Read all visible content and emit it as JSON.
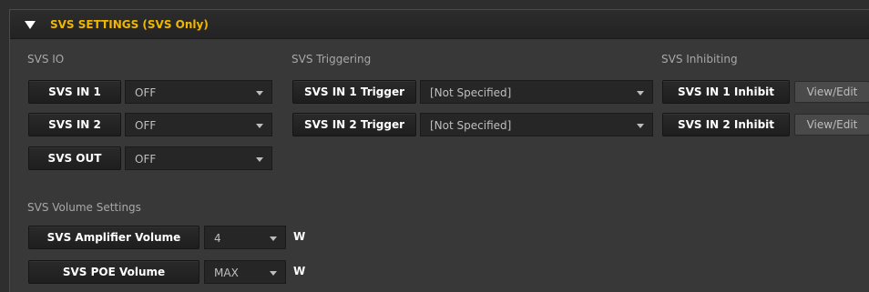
{
  "header": {
    "title": "SVS SETTINGS (SVS Only)"
  },
  "io": {
    "label": "SVS IO",
    "rows": [
      {
        "button": "SVS IN 1",
        "value": "OFF"
      },
      {
        "button": "SVS IN 2",
        "value": "OFF"
      },
      {
        "button": "SVS OUT",
        "value": "OFF"
      }
    ]
  },
  "triggering": {
    "label": "SVS Triggering",
    "rows": [
      {
        "button": "SVS IN 1 Trigger",
        "value": "[Not Specified]"
      },
      {
        "button": "SVS IN 2 Trigger",
        "value": "[Not Specified]"
      }
    ]
  },
  "inhibiting": {
    "label": "SVS Inhibiting",
    "rows": [
      {
        "button": "SVS IN 1 Inhibit",
        "action": "View/Edit"
      },
      {
        "button": "SVS IN 2 Inhibit",
        "action": "View/Edit"
      }
    ]
  },
  "volume": {
    "label": "SVS Volume Settings",
    "rows": [
      {
        "button": "SVS Amplifier Volume",
        "value": "4",
        "unit": "W"
      },
      {
        "button": "SVS POE Volume",
        "value": "MAX",
        "unit": "W"
      }
    ]
  },
  "colors": {
    "accent": "#f0b800",
    "panel": "#383838",
    "header": "#232323"
  }
}
